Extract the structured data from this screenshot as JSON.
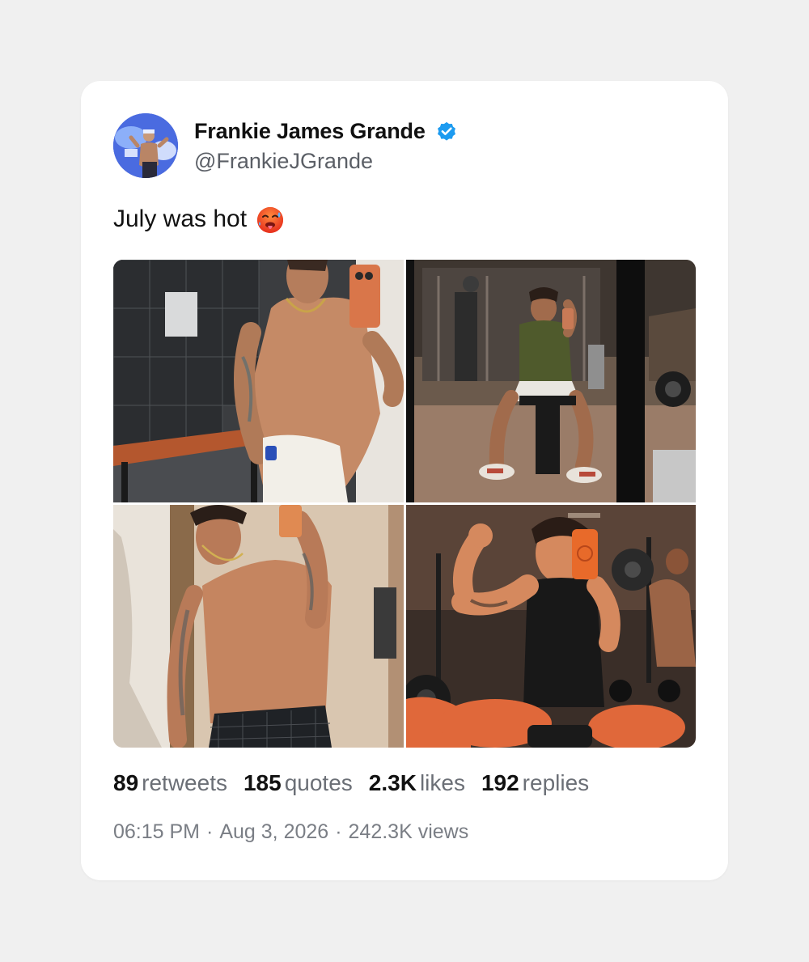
{
  "author": {
    "display_name": "Frankie James Grande",
    "handle": "@FrankieJGrande",
    "verified": true,
    "avatar_icon": "profile-photo",
    "verified_color": "#1d9bf0"
  },
  "tweet": {
    "text": "July was hot",
    "emoji": "hot-face-emoji"
  },
  "media": {
    "count": 4,
    "photos": [
      {
        "icon": "locker-room-selfie-photo"
      },
      {
        "icon": "gym-mirror-seated-photo"
      },
      {
        "icon": "mirror-selfie-photo"
      },
      {
        "icon": "gym-flex-selfie-photo"
      }
    ]
  },
  "stats": {
    "retweets": {
      "value": "89",
      "label": "retweets"
    },
    "quotes": {
      "value": "185",
      "label": "quotes"
    },
    "likes": {
      "value": "2.3K",
      "label": "likes"
    },
    "replies": {
      "value": "192",
      "label": "replies"
    }
  },
  "meta": {
    "time": "06:15 PM",
    "separator": "·",
    "date": "Aug 3, 2026",
    "views": "242.3K views"
  },
  "colors": {
    "page_background": "#f0f0f0",
    "card_background": "#ffffff",
    "primary_text": "#111111",
    "secondary_text": "#5b5f66",
    "meta_text": "#7a7e85"
  }
}
